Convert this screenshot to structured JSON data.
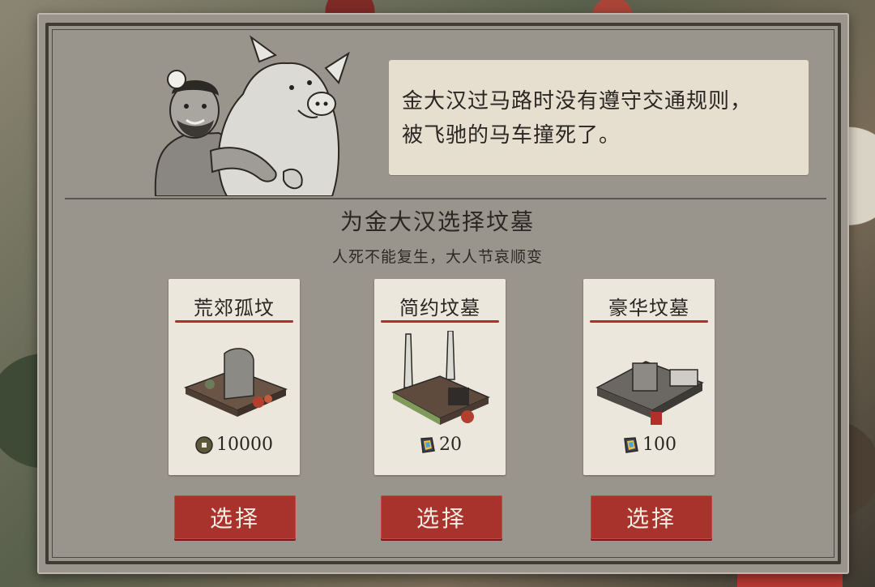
{
  "story": {
    "line1": "金大汉过马路时没有遵守交通规则，",
    "line2": "被飞驰的马车撞死了。"
  },
  "grave_selection": {
    "title": "为金大汉选择坟墓",
    "subtitle": "人死不能复生，大人节哀顺变"
  },
  "options": [
    {
      "name": "荒郊孤坟",
      "price": "10000",
      "currency_icon": "copper-coin-icon",
      "select_label": "选择"
    },
    {
      "name": "简约坟墓",
      "price": "20",
      "currency_icon": "jade-gem-icon",
      "select_label": "选择"
    },
    {
      "name": "豪华坟墓",
      "price": "100",
      "currency_icon": "jade-gem-icon",
      "select_label": "选择"
    }
  ],
  "colors": {
    "accent_red": "#a8322c",
    "panel_bg": "#9a958c",
    "card_bg": "#ece7dc"
  }
}
